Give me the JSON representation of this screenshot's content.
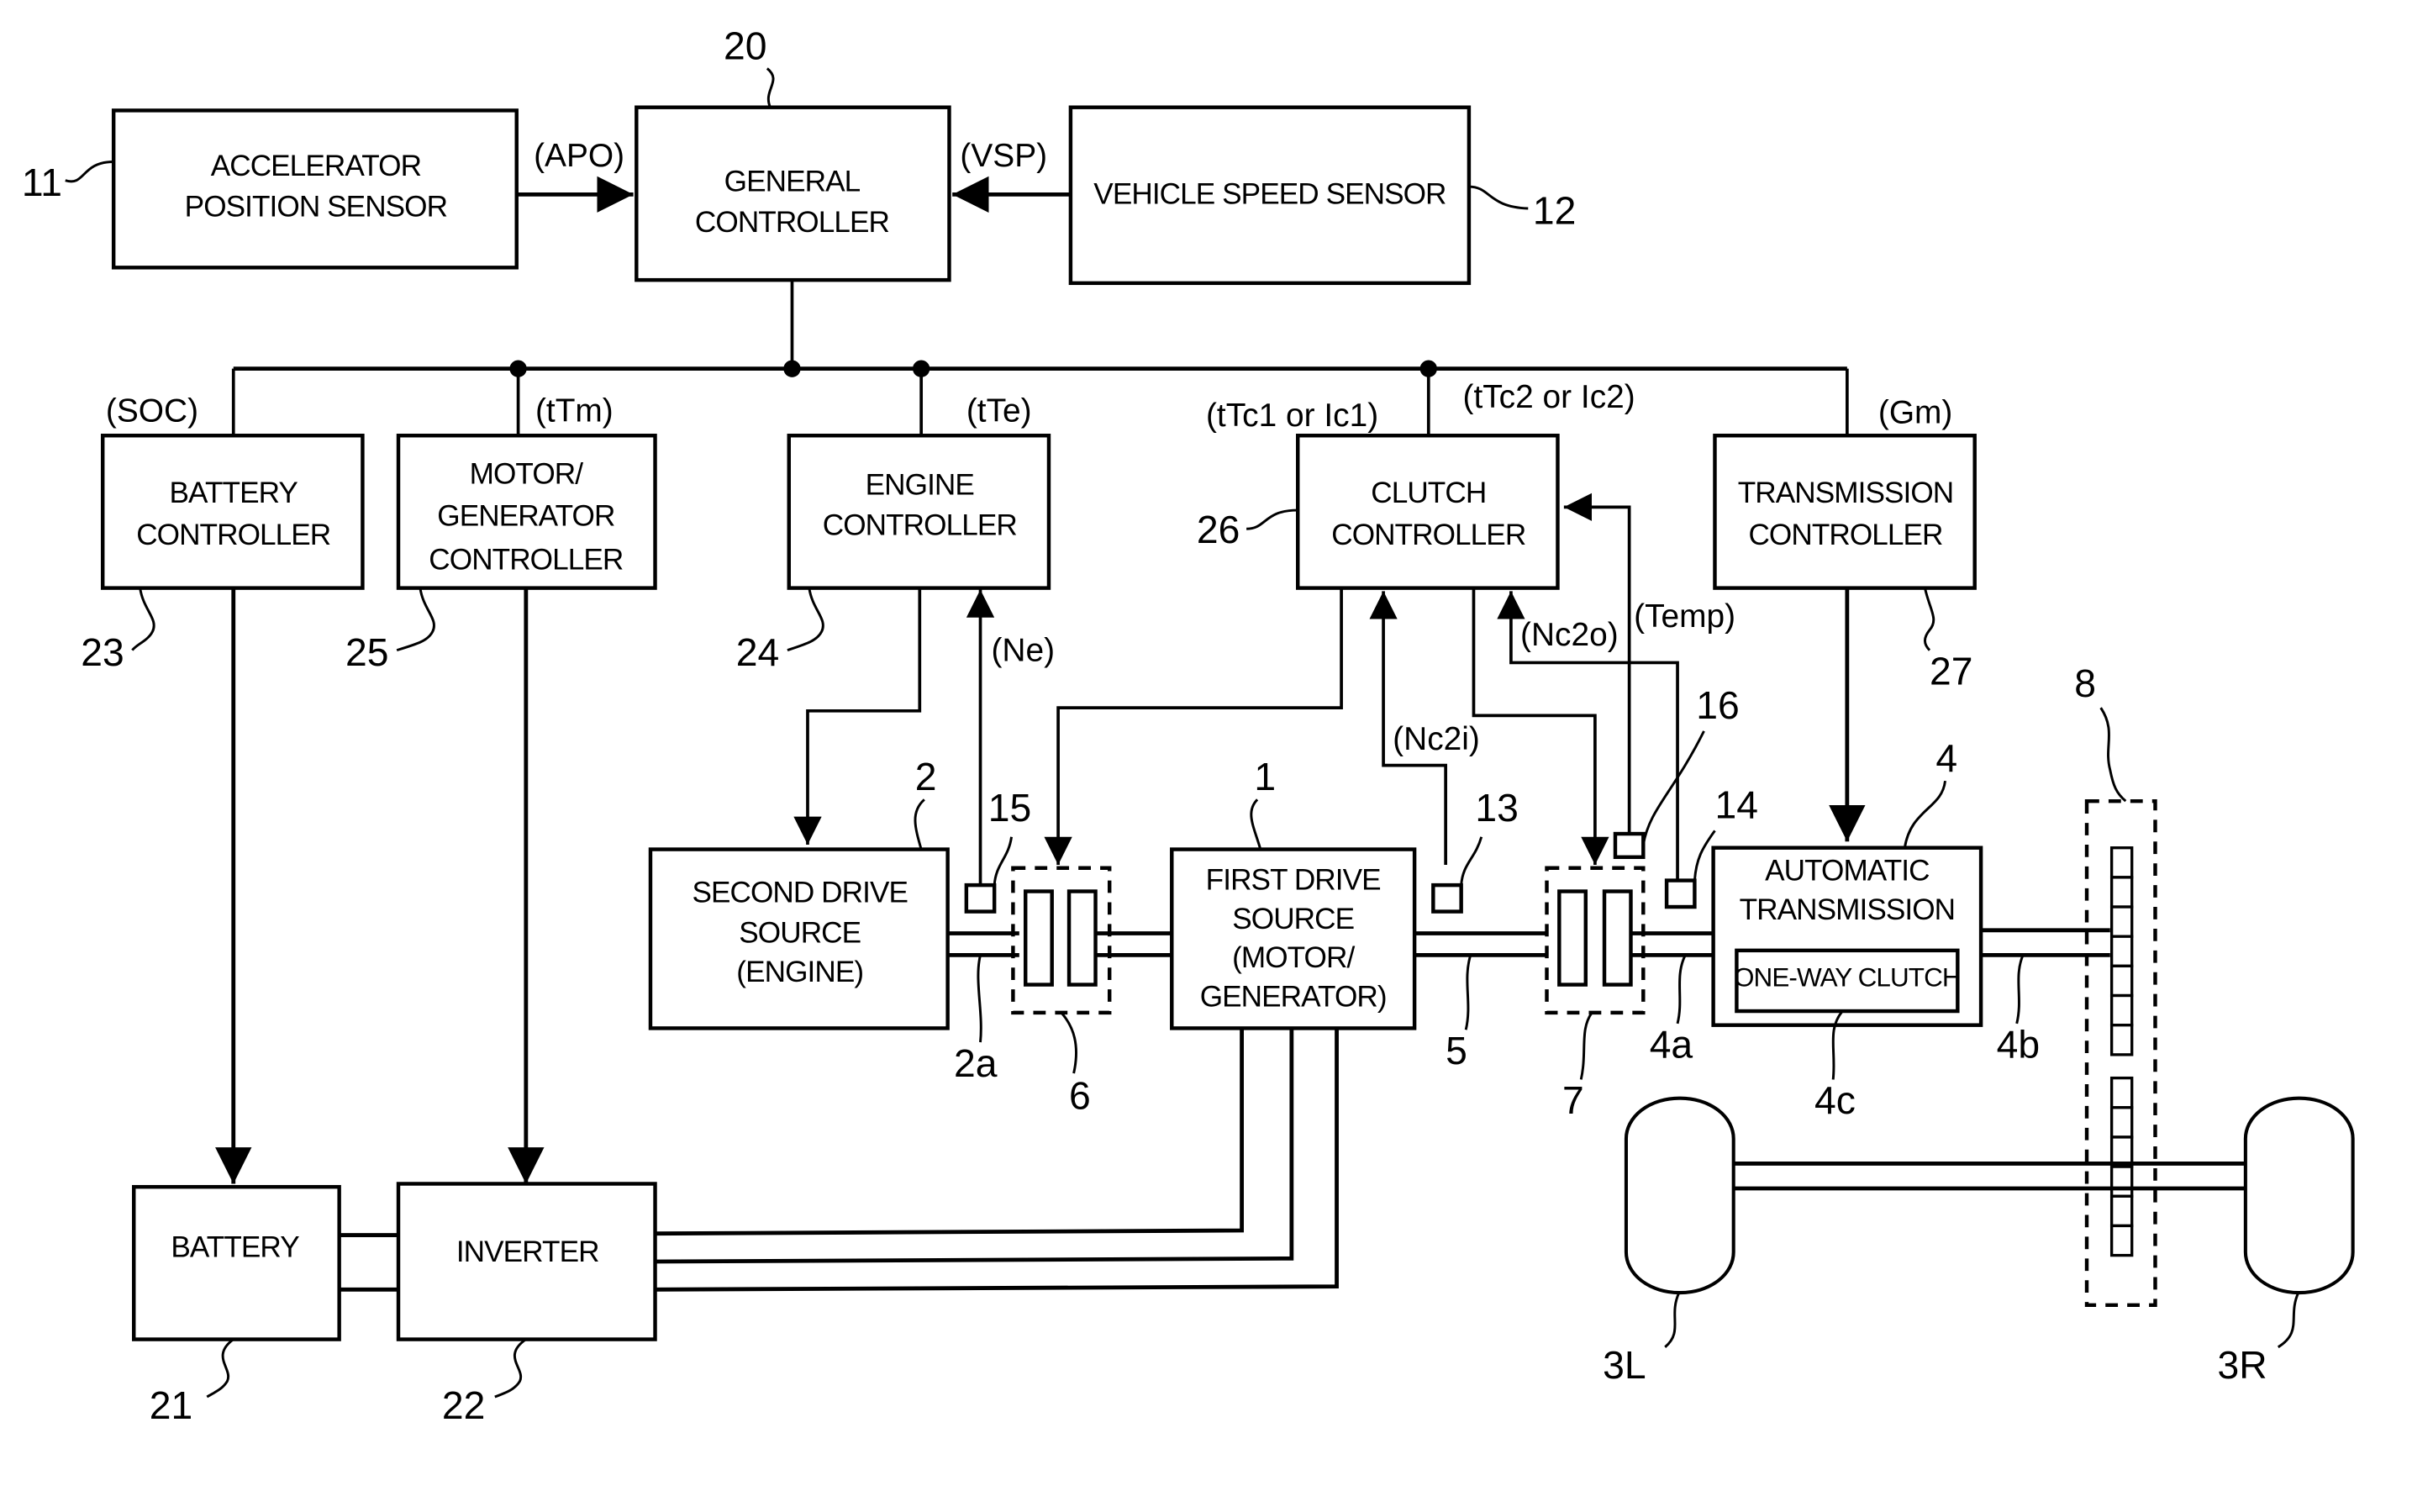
{
  "blocks": {
    "accel_sensor": {
      "ref": "11",
      "lines": [
        "ACCELERATOR",
        "POSITION SENSOR"
      ]
    },
    "general_controller": {
      "ref": "20",
      "lines": [
        "GENERAL",
        "CONTROLLER"
      ]
    },
    "vehicle_speed_sensor": {
      "ref": "12",
      "lines": [
        "VEHICLE SPEED SENSOR"
      ]
    },
    "battery_controller": {
      "ref": "23",
      "lines": [
        "BATTERY",
        "CONTROLLER"
      ]
    },
    "mg_controller": {
      "ref": "25",
      "lines": [
        "MOTOR/",
        "GENERATOR",
        "CONTROLLER"
      ]
    },
    "engine_controller": {
      "ref": "24",
      "lines": [
        "ENGINE",
        "CONTROLLER"
      ]
    },
    "clutch_controller": {
      "ref": "26",
      "lines": [
        "CLUTCH",
        "CONTROLLER"
      ]
    },
    "transmission_controller": {
      "ref": "27",
      "lines": [
        "TRANSMISSION",
        "CONTROLLER"
      ]
    },
    "second_drive_source": {
      "ref": "2",
      "lines": [
        "SECOND DRIVE",
        "SOURCE",
        "(ENGINE)"
      ]
    },
    "first_drive_source": {
      "ref": "1",
      "lines": [
        "FIRST DRIVE",
        "SOURCE",
        "(MOTOR/",
        "GENERATOR)"
      ]
    },
    "automatic_transmission": {
      "ref": "4",
      "lines": [
        "AUTOMATIC",
        "TRANSMISSION"
      ]
    },
    "one_way_clutch": {
      "ref": "4c",
      "lines": [
        "ONE-WAY CLUTCH"
      ]
    },
    "battery": {
      "ref": "21",
      "lines": [
        "BATTERY"
      ]
    },
    "inverter": {
      "ref": "22",
      "lines": [
        "INVERTER"
      ]
    }
  },
  "signals": {
    "apo": "(APO)",
    "vsp": "(VSP)",
    "soc": "(SOC)",
    "ttm": "(tTm)",
    "tte": "(tTe)",
    "ttc1": "(tTc1 or Ic1)",
    "ttc2": "(tTc2 or Ic2)",
    "gm": "(Gm)",
    "ne": "(Ne)",
    "nc2i": "(Nc2i)",
    "nc2o": "(Nc2o)",
    "temp": "(Temp)"
  },
  "refs": {
    "shaft_2a": "2a",
    "clutch_6": "6",
    "shaft_5": "5",
    "clutch_7": "7",
    "shaft_4a": "4a",
    "shaft_4b": "4b",
    "sensor_13": "13",
    "sensor_14": "14",
    "sensor_15": "15",
    "sensor_16": "16",
    "diff_8": "8",
    "wheel_left": "3L",
    "wheel_right": "3R"
  }
}
